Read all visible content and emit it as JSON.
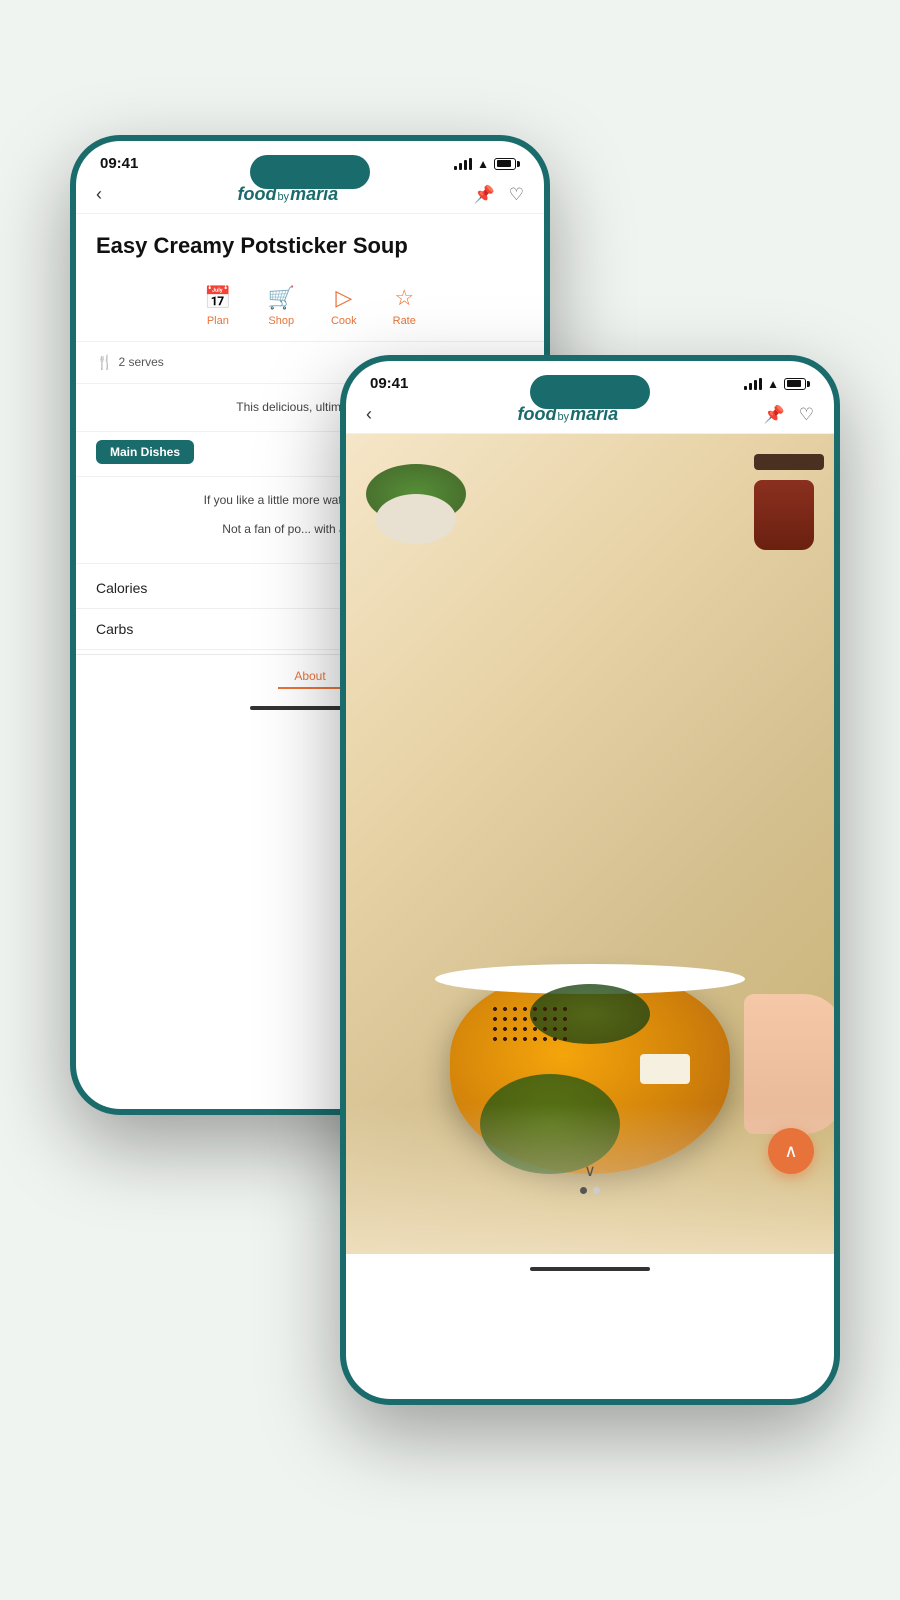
{
  "app": {
    "logo_food": "food",
    "logo_by": "by",
    "logo_maria": "maria",
    "time": "09:41"
  },
  "back_phone": {
    "recipe_title": "Easy Creamy Potsticker Soup",
    "actions": [
      {
        "id": "plan",
        "icon": "📅",
        "label": "Plan"
      },
      {
        "id": "shop",
        "icon": "🛒",
        "label": "Shop"
      },
      {
        "id": "cook",
        "icon": "▷",
        "label": "Cook"
      },
      {
        "id": "rate",
        "icon": "☆",
        "label": "Rate"
      }
    ],
    "meta": {
      "serves": "2 serves",
      "serves_icon": "🍴"
    },
    "description": "This delicious, ultimate fla...",
    "tag": "Main Dishes",
    "tips": [
      "If you like a little more water and more...",
      "Not a fan of po... with a serving..."
    ],
    "nutrition": [
      {
        "label": "Calories"
      },
      {
        "label": "Carbs"
      }
    ],
    "tabs": [
      {
        "id": "about",
        "label": "About",
        "active": true
      }
    ]
  },
  "front_phone": {
    "nav": {
      "back_icon": "‹",
      "pin_icon": "📌",
      "heart_icon": "♡"
    },
    "scroll_dots": [
      {
        "active": true
      },
      {
        "active": false
      }
    ],
    "fab_icon": "∧"
  }
}
